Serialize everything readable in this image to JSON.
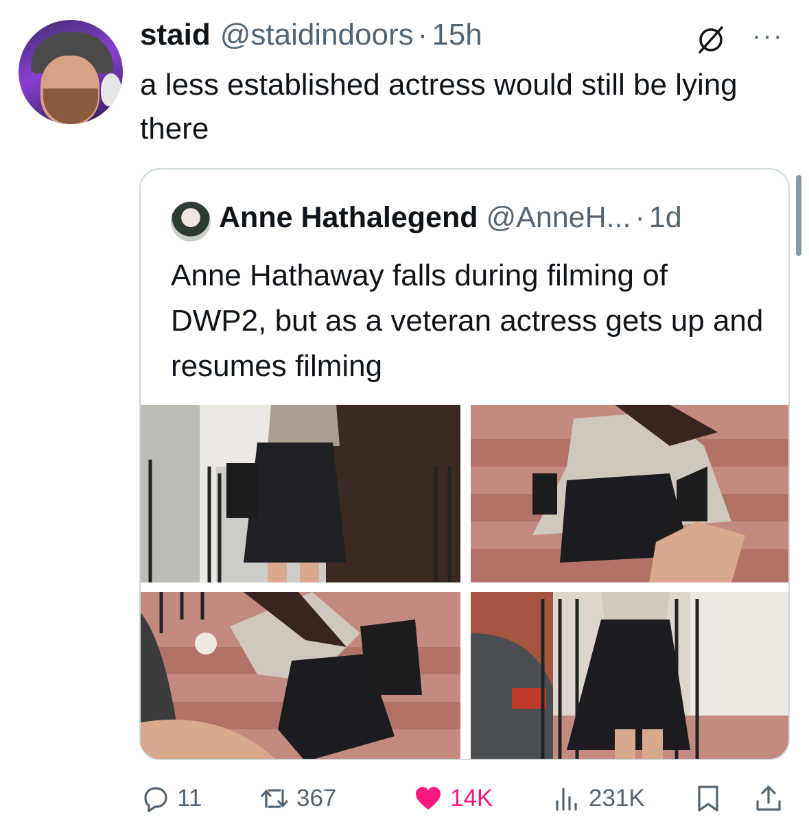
{
  "tweet": {
    "author_name": "staid",
    "author_handle": "@staidindoors",
    "separator": "·",
    "time": "15h",
    "text": "a less established actress would still be lying there",
    "more_icon": "ellipsis-icon",
    "no_sign_icon": "no-sign-icon"
  },
  "quote": {
    "author_name": "Anne Hathalegend",
    "author_handle": "@AnneH...",
    "separator": "·",
    "time": "1d",
    "text": "Anne Hathaway falls during filming of DWP2, but as a veteran actress gets up and resumes filming",
    "photos": [
      {
        "icon": "photo-walking-icon"
      },
      {
        "icon": "photo-falling-icon"
      },
      {
        "icon": "photo-getting-up-icon"
      },
      {
        "icon": "photo-resuming-icon"
      }
    ]
  },
  "actions": {
    "replies": "11",
    "reposts": "367",
    "likes": "14K",
    "views": "231K"
  },
  "colors": {
    "text": "#0f1419",
    "secondary": "#536471",
    "like": "#f91880",
    "border": "#cfd9de"
  }
}
